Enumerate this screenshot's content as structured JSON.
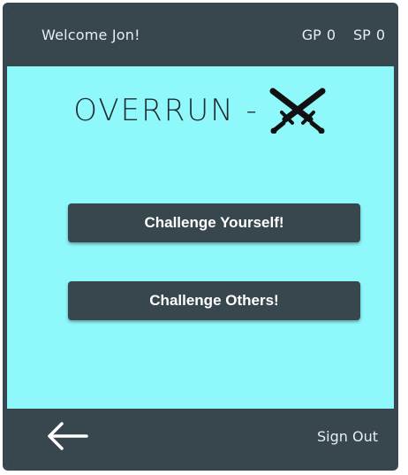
{
  "header": {
    "welcome": "Welcome Jon!",
    "gp_label": "GP",
    "gp_value": "0",
    "sp_label": "SP",
    "sp_value": "0"
  },
  "main": {
    "title": "OVERRUN -",
    "title_icon": "crossed-swords-icon",
    "buttons": [
      {
        "label": "Challenge Yourself!"
      },
      {
        "label": "Challenge Others!"
      }
    ]
  },
  "footer": {
    "back_icon": "arrow-left-icon",
    "signout": "Sign Out"
  },
  "colors": {
    "bar_background": "#37474d",
    "page_background": "#8ef8fb",
    "button_background": "#37474d"
  }
}
